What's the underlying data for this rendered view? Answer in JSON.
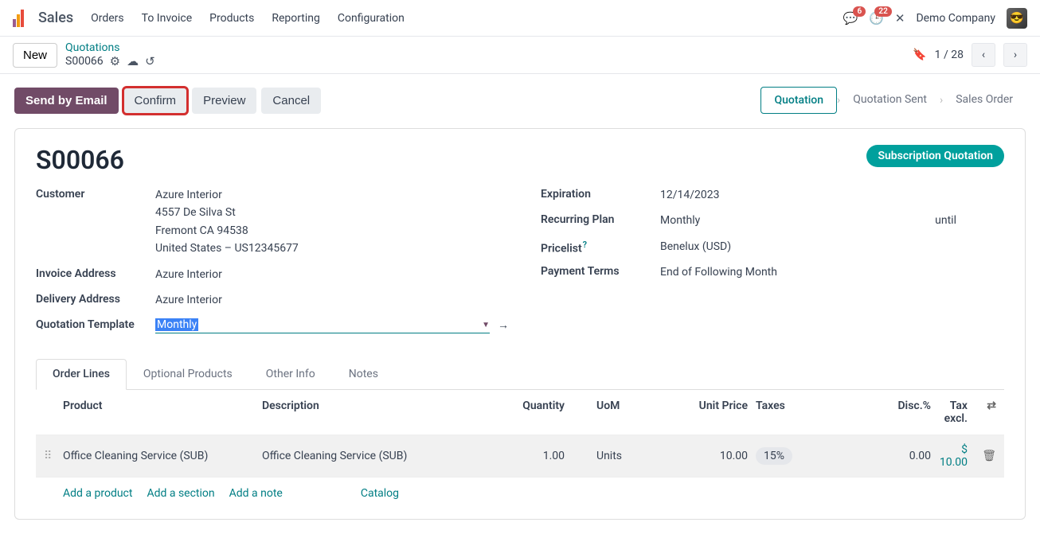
{
  "top": {
    "app": "Sales",
    "menu": [
      "Orders",
      "To Invoice",
      "Products",
      "Reporting",
      "Configuration"
    ],
    "messages_badge": "6",
    "activities_badge": "22",
    "company": "Demo Company"
  },
  "control": {
    "new_btn": "New",
    "bc_link": "Quotations",
    "bc_id": "S00066",
    "pager": "1 / 28"
  },
  "actions": {
    "send": "Send by Email",
    "confirm": "Confirm",
    "preview": "Preview",
    "cancel": "Cancel"
  },
  "stages": {
    "quotation": "Quotation",
    "sent": "Quotation Sent",
    "order": "Sales Order"
  },
  "ribbon": "Subscription Quotation",
  "title": "S00066",
  "left": {
    "customer_label": "Customer",
    "customer_name": "Azure Interior",
    "customer_addr1": "4557 De Silva St",
    "customer_addr2": "Fremont CA 94538",
    "customer_addr3": "United States – US12345677",
    "invoice_label": "Invoice Address",
    "invoice_value": "Azure Interior",
    "delivery_label": "Delivery Address",
    "delivery_value": "Azure Interior",
    "template_label": "Quotation Template",
    "template_value": "Monthly"
  },
  "right": {
    "expiration_label": "Expiration",
    "expiration_value": "12/14/2023",
    "recurring_label": "Recurring Plan",
    "recurring_value": "Monthly",
    "recurring_until": "until",
    "pricelist_label": "Pricelist",
    "pricelist_value": "Benelux (USD)",
    "payment_label": "Payment Terms",
    "payment_value": "End of Following Month"
  },
  "tabs": {
    "lines": "Order Lines",
    "optional": "Optional Products",
    "other": "Other Info",
    "notes": "Notes"
  },
  "grid": {
    "head": {
      "product": "Product",
      "desc": "Description",
      "qty": "Quantity",
      "uom": "UoM",
      "price": "Unit Price",
      "taxes": "Taxes",
      "disc": "Disc.%",
      "taxex": "Tax excl."
    },
    "row": {
      "product": "Office Cleaning Service (SUB)",
      "desc": "Office Cleaning Service (SUB)",
      "qty": "1.00",
      "uom": "Units",
      "price": "10.00",
      "taxes": "15%",
      "disc": "0.00",
      "taxex": "$ 10.00"
    },
    "add_product": "Add a product",
    "add_section": "Add a section",
    "add_note": "Add a note",
    "catalog": "Catalog"
  }
}
